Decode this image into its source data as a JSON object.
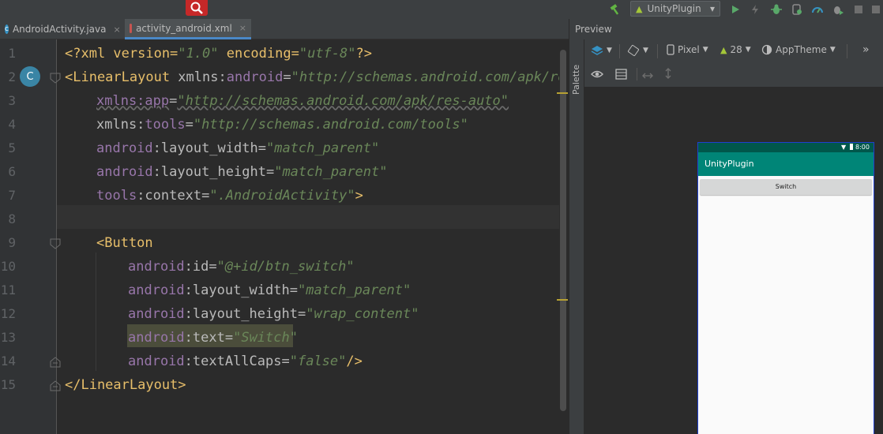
{
  "tabs": [
    {
      "label": "AndroidActivity.java",
      "close": "×",
      "icon": "java-class-icon"
    },
    {
      "label": "activity_android.xml",
      "close": "×",
      "icon": "layout-xml-icon"
    }
  ],
  "toolbar": {
    "run_config": "UnityPlugin",
    "run_config_caret": "▾"
  },
  "preview": {
    "title": "Preview",
    "palette_label": "Palette",
    "device": "Pixel",
    "api_level": "28",
    "theme": "AppTheme",
    "more": "»"
  },
  "device_preview": {
    "time": "8:00",
    "app_title": "UnityPlugin",
    "button_text": "Switch"
  },
  "line_numbers": [
    "1",
    "2",
    "3",
    "4",
    "5",
    "6",
    "7",
    "8",
    "9",
    "10",
    "11",
    "12",
    "13",
    "14",
    "15"
  ],
  "code": {
    "l1": {
      "open": "<?xml version=",
      "v1": "\"1.0\"",
      "mid": " encoding=",
      "v2": "\"utf-8\"",
      "close": "?>"
    },
    "l2": {
      "tag": "<LinearLayout ",
      "a1": "xmlns:",
      "ns": "android",
      "eq": "=",
      "val": "\"http://schemas.android.com/apk/res/android\""
    },
    "l3": {
      "attr": "xmlns:app",
      "eq": "=",
      "val": "\"http://schemas.android.com/apk/res-auto\""
    },
    "l4": {
      "a1": "xmlns:",
      "ns": "tools",
      "eq": "=",
      "val": "\"http://schemas.android.com/tools\""
    },
    "l5": {
      "ns": "android",
      "attr": ":layout_width",
      "eq": "=",
      "val": "\"match_parent\""
    },
    "l6": {
      "ns": "android",
      "attr": ":layout_height",
      "eq": "=",
      "val": "\"match_parent\""
    },
    "l7": {
      "ns": "tools",
      "attr": ":context",
      "eq": "=",
      "val": "\".AndroidActivity\"",
      "close": ">"
    },
    "l9": {
      "tag": "<Button"
    },
    "l10": {
      "ns": "android",
      "attr": ":id",
      "eq": "=",
      "val": "\"@+id/btn_switch\""
    },
    "l11": {
      "ns": "android",
      "attr": ":layout_width",
      "eq": "=",
      "val": "\"match_parent\""
    },
    "l12": {
      "ns": "android",
      "attr": ":layout_height",
      "eq": "=",
      "val": "\"wrap_content\""
    },
    "l13": {
      "ns": "android",
      "attr": ":text",
      "eq": "=",
      "val": "\"Switch\""
    },
    "l14": {
      "ns": "android",
      "attr": ":textAllCaps",
      "eq": "=",
      "val": "\"false\"",
      "close": "/>"
    },
    "l15": {
      "tag": "</LinearLayout>"
    }
  },
  "gutter_badge": "C"
}
